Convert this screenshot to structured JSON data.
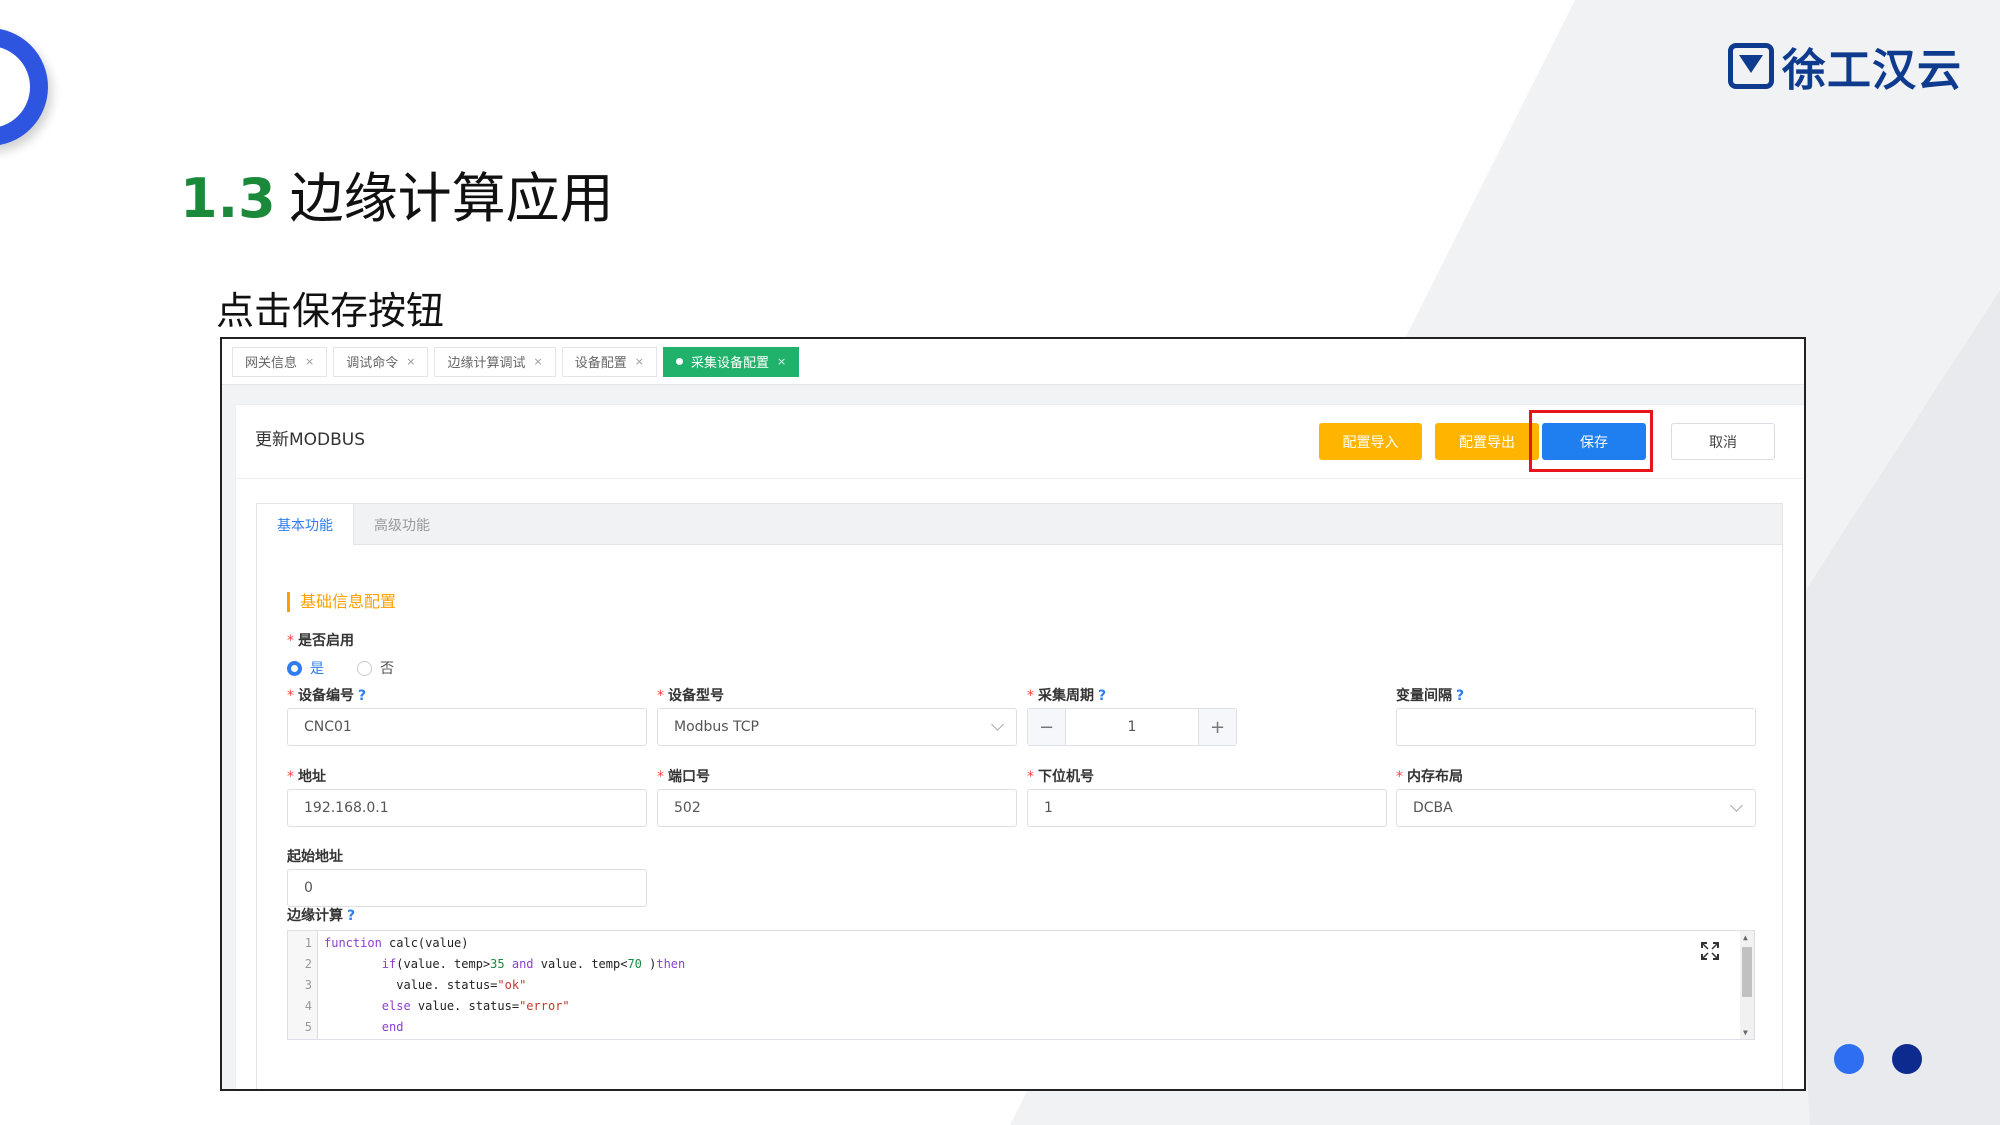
{
  "logo": {
    "text": "徐工汉云"
  },
  "slide": {
    "section_number": "1.3",
    "title": "边缘计算应用",
    "subtitle": "点击保存按钮"
  },
  "page_tabs": [
    {
      "label": "网关信息",
      "active": false
    },
    {
      "label": "调试命令",
      "active": false
    },
    {
      "label": "边缘计算调试",
      "active": false
    },
    {
      "label": "设备配置",
      "active": false
    },
    {
      "label": "采集设备配置",
      "active": true
    }
  ],
  "panel": {
    "title": "更新MODBUS",
    "import_label": "配置导入",
    "export_label": "配置导出",
    "save_label": "保存",
    "cancel_label": "取消"
  },
  "inner_tabs": [
    {
      "label": "基本功能",
      "active": true
    },
    {
      "label": "高级功能",
      "active": false
    }
  ],
  "section_title": "基础信息配置",
  "form": {
    "enable": {
      "label": "是否启用",
      "yes": "是",
      "no": "否",
      "selected": "是"
    },
    "device_no": {
      "label": "设备编号",
      "value": "CNC01"
    },
    "device_model": {
      "label": "设备型号",
      "value": "Modbus TCP"
    },
    "collect_cycle": {
      "label": "采集周期",
      "value": "1"
    },
    "var_interval": {
      "label": "变量间隔",
      "value": ""
    },
    "address": {
      "label": "地址",
      "value": "192.168.0.1"
    },
    "port": {
      "label": "端口号",
      "value": "502"
    },
    "slave_id": {
      "label": "下位机号",
      "value": "1"
    },
    "memory_layout": {
      "label": "内存布局",
      "value": "DCBA"
    },
    "start_address": {
      "label": "起始地址",
      "value": "0"
    },
    "edge_compute": {
      "label": "边缘计算"
    }
  },
  "code": {
    "line_numbers": [
      "1",
      "2",
      "3",
      "4",
      "5"
    ],
    "l1_kw": "function",
    "l1_rest": " calc(value)",
    "l2_kw": "if",
    "l2_a": "(value. temp>",
    "l2_n1": "35",
    "l2_and": " and",
    "l2_b": " value. temp<",
    "l2_n2": "70",
    "l2_c": " )",
    "l2_then": "then",
    "l3_a": "value. status=",
    "l3_str": "\"ok\"",
    "l4_kw": "else",
    "l4_a": " value. status=",
    "l4_str": "\"error\"",
    "l5_kw": "end"
  },
  "colors": {
    "accent_blue": "#1f7ef0",
    "warning_orange": "#ffb400",
    "active_tab_green": "#20b26b",
    "highlight_red": "#e8141b",
    "logo_navy": "#0f3b8f"
  }
}
